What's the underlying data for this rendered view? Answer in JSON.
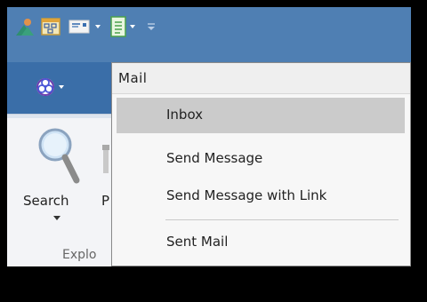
{
  "menu": {
    "header": "Mail",
    "items": [
      {
        "label": "Inbox",
        "selected": true
      },
      {
        "label": "Send Message"
      },
      {
        "label": "Send Message with Link"
      },
      {
        "label": "Sent Mail"
      }
    ]
  },
  "ribbon": {
    "search_label": "Search",
    "partial_label": "P",
    "group_label": "Explo"
  },
  "icons": {
    "qat": [
      "person-icon",
      "diagram-icon",
      "mail-icon",
      "document-icon",
      "overflow-icon"
    ],
    "tab": "network-icon"
  },
  "colors": {
    "title_bar": "#4f7fb3",
    "tab_row": "#3a6ea8",
    "menu_selected": "#cbcbcb"
  }
}
